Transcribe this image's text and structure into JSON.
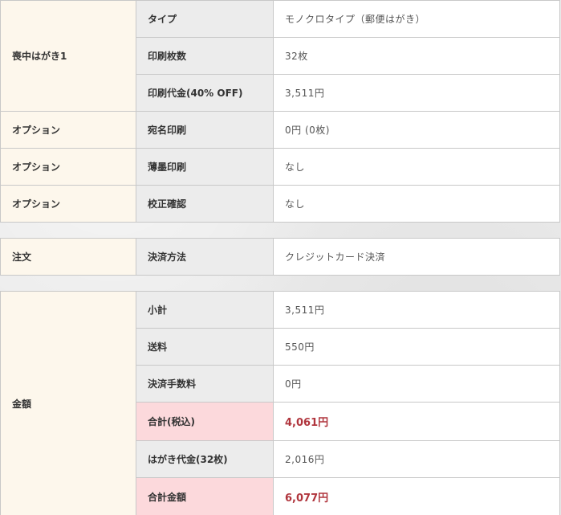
{
  "product": {
    "heading": "喪中はがき1",
    "rows": [
      {
        "label": "タイプ",
        "value": "モノクロタイプ（郵便はがき）"
      },
      {
        "label": "印刷枚数",
        "value": "32枚"
      },
      {
        "label": "印刷代金(40% OFF)",
        "value": "3,511円"
      }
    ]
  },
  "options": [
    {
      "heading": "オプション",
      "label": "宛名印刷",
      "value": "0円 (0枚)"
    },
    {
      "heading": "オプション",
      "label": "薄墨印刷",
      "value": "なし"
    },
    {
      "heading": "オプション",
      "label": "校正確認",
      "value": "なし"
    }
  ],
  "order": {
    "heading": "注文",
    "label": "決済方法",
    "value": "クレジットカード決済"
  },
  "amount": {
    "heading": "金額",
    "rows": [
      {
        "label": "小計",
        "value": "3,511円"
      },
      {
        "label": "送料",
        "value": "550円"
      },
      {
        "label": "決済手数料",
        "value": "0円"
      },
      {
        "label": "合計(税込)",
        "value": "4,061円"
      },
      {
        "label": "はがき代金(32枚)",
        "value": "2,016円"
      },
      {
        "label": "合計金額",
        "value": "6,077円"
      }
    ]
  }
}
